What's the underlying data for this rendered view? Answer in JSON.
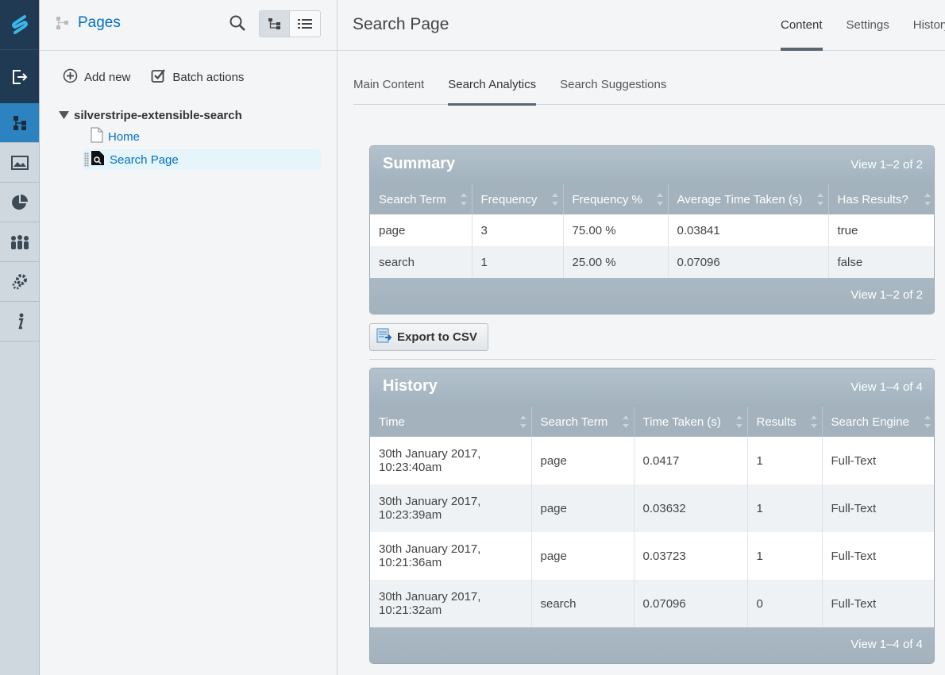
{
  "rail": {
    "items": [
      "logo-icon",
      "logout-icon",
      "pages-icon",
      "files-icon",
      "reports-icon",
      "security-icon",
      "settings-icon",
      "help-icon"
    ],
    "active": "pages-icon"
  },
  "tree": {
    "title": "Pages",
    "add_new": "Add new",
    "batch_actions": "Batch actions",
    "root": "silverstripe-extensible-search",
    "nodes": [
      "Home",
      "Search Page"
    ]
  },
  "main": {
    "title": "Search Page",
    "top_tabs": [
      "Content",
      "Settings",
      "History"
    ],
    "sub_tabs": [
      "Main Content",
      "Search Analytics",
      "Search Suggestions"
    ]
  },
  "summary": {
    "title": "Summary",
    "view_label": "View 1–2 of 2",
    "columns": [
      "Search Term",
      "Frequency",
      "Frequency %",
      "Average Time Taken (s)",
      "Has Results?"
    ],
    "rows": [
      [
        "page",
        "3",
        "75.00 %",
        "0.03841",
        "true"
      ],
      [
        "search",
        "1",
        "25.00 %",
        "0.07096",
        "false"
      ]
    ],
    "footer_label": "View 1–2 of 2"
  },
  "export": {
    "label": "Export to CSV"
  },
  "history": {
    "title": "History",
    "view_label": "View 1–4 of 4",
    "columns": [
      "Time",
      "Search Term",
      "Time Taken (s)",
      "Results",
      "Search Engine"
    ],
    "rows": [
      [
        "30th January 2017,",
        "10:23:40am",
        "page",
        "0.0417",
        "1",
        "Full-Text"
      ],
      [
        "30th January 2017,",
        "10:23:39am",
        "page",
        "0.03632",
        "1",
        "Full-Text"
      ],
      [
        "30th January 2017,",
        "10:21:36am",
        "page",
        "0.03723",
        "1",
        "Full-Text"
      ],
      [
        "30th January 2017,",
        "10:21:32am",
        "search",
        "0.07096",
        "0",
        "Full-Text"
      ]
    ],
    "footer_label": "View 1–4 of 4"
  }
}
